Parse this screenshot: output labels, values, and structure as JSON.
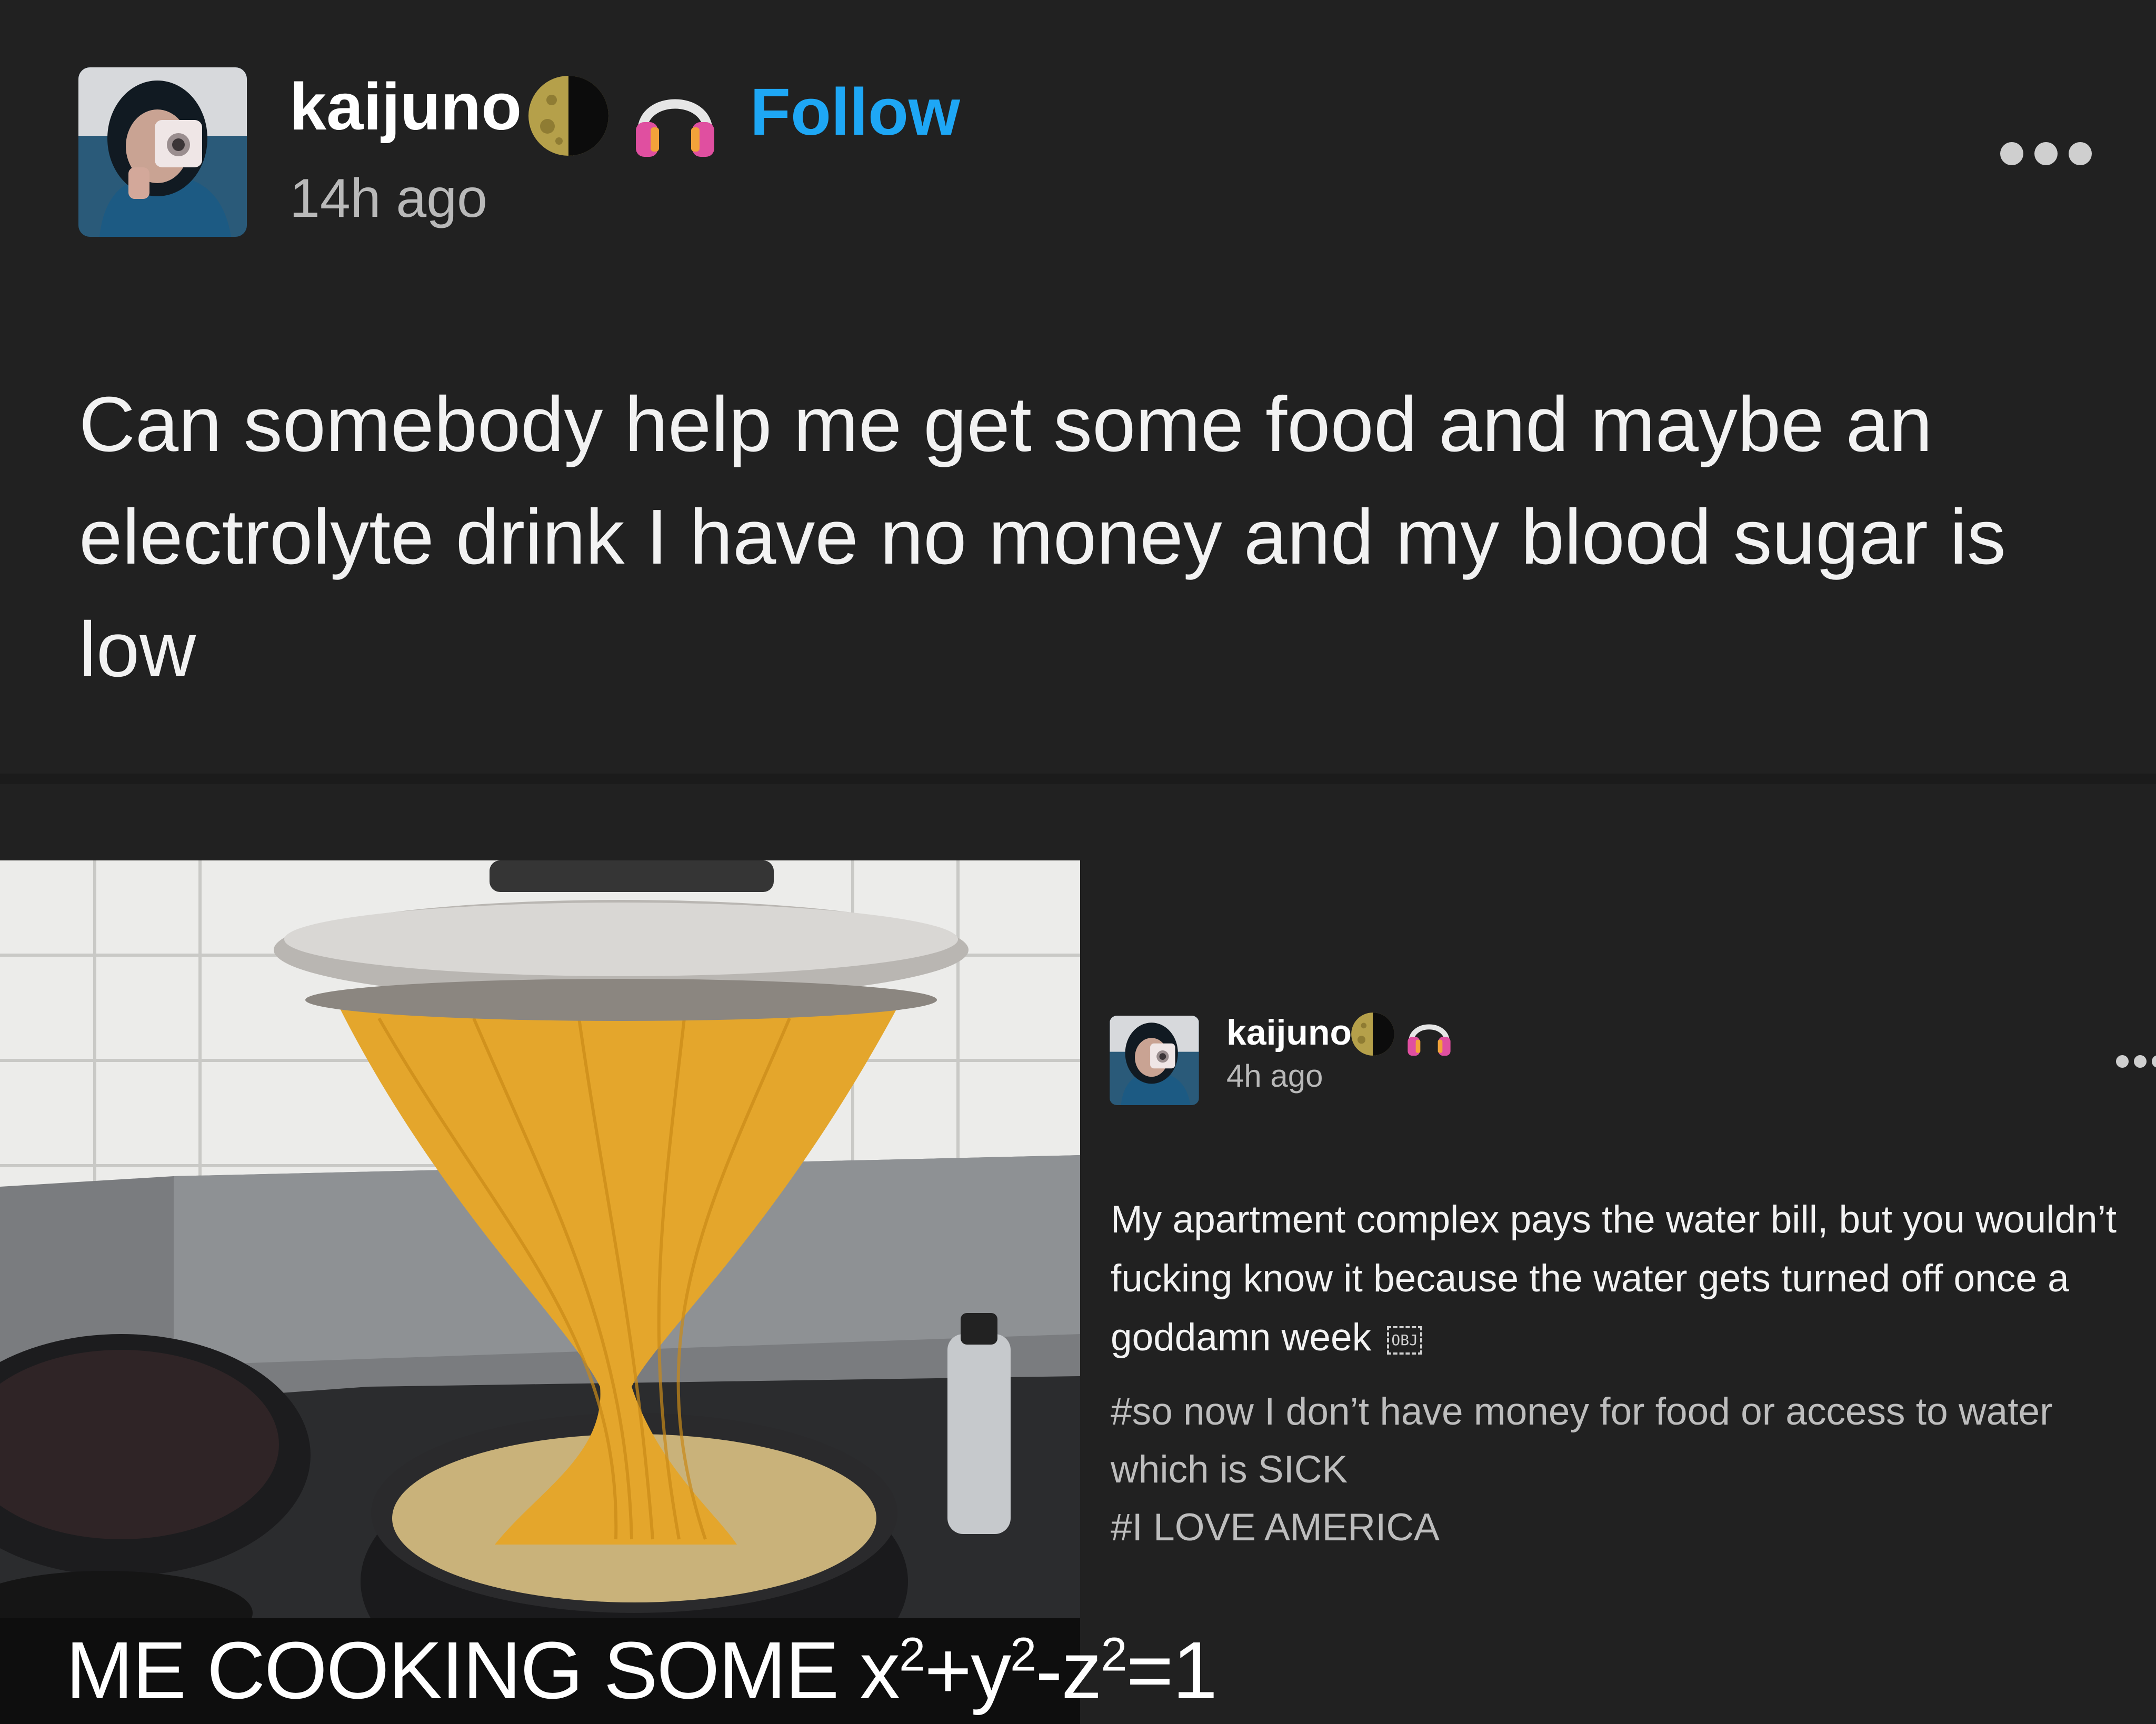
{
  "post": {
    "username": "kaijuno",
    "time": "14h ago",
    "follow_label": "Follow",
    "text": "Can somebody help me get some food and maybe an electrolyte drink I have no money and my blood sugar is low"
  },
  "meme": {
    "caption_prefix": "ME COOKING SOME x",
    "caption_sup1": "2",
    "caption_mid1": "+y",
    "caption_sup2": "2",
    "caption_mid2": "-z",
    "caption_sup3": "2",
    "caption_end": "=1"
  },
  "reblog": {
    "username": "kaijuno",
    "time": "4h ago",
    "text": "My apartment complex pays the water bill, but you wouldn’t fucking know it because the water gets turned off once a goddamn week",
    "obj_label": "OBJ",
    "tags": [
      "#so now I don’t have money for food or access to water which is SICK",
      "#I LOVE AMERICA"
    ]
  },
  "icons": {
    "moon": "moon-icon",
    "headphones": "headphones-icon",
    "more": "more-options-icon"
  },
  "colors": {
    "background": "#212121",
    "follow": "#1ea7f5",
    "secondary_text": "#b9b9b9",
    "headphones": "#e04fa0"
  }
}
